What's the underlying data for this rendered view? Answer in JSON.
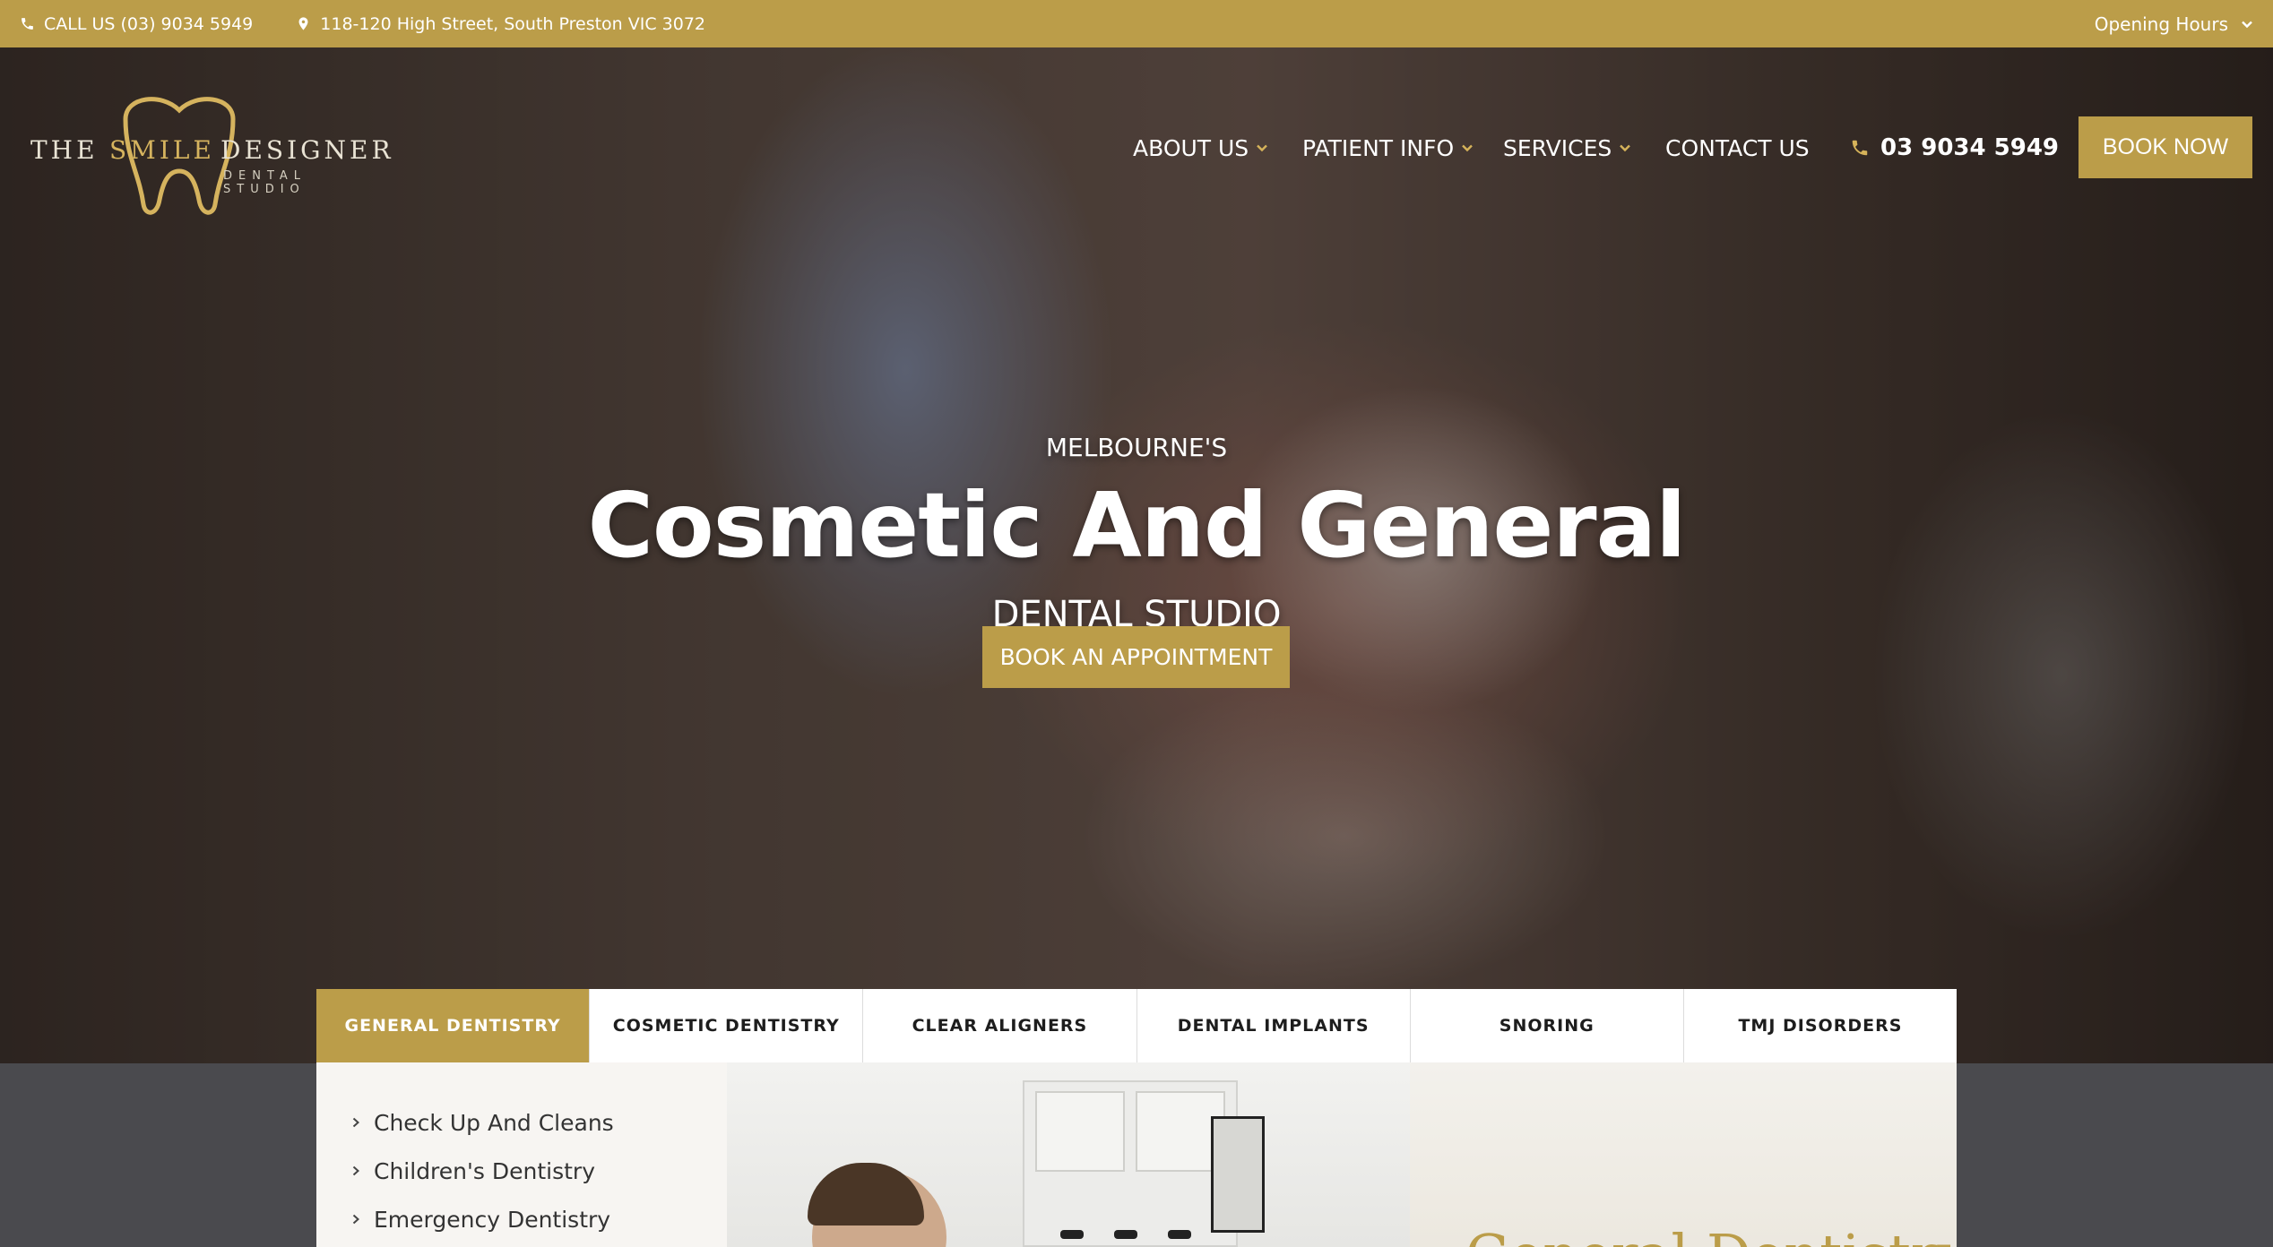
{
  "topbar": {
    "call": "CALL US (03) 9034 5949",
    "address": "118-120 High Street, South Preston VIC 3072",
    "hours": "Opening Hours"
  },
  "logo": {
    "word1": "THE",
    "word2": "SMILE",
    "word3": "DESIGNER",
    "subtitle": "DENTAL STUDIO"
  },
  "nav": {
    "about": "ABOUT US",
    "patient": "PATIENT INFO",
    "services": "SERVICES",
    "contact": "CONTACT US",
    "phone": "03 9034 5949",
    "book": "BOOK NOW"
  },
  "hero": {
    "kicker": "MELBOURNE'S",
    "headline": "Cosmetic And General",
    "subline": "DENTAL STUDIO",
    "cta": "BOOK AN APPOINTMENT"
  },
  "tabs": [
    "GENERAL DENTISTRY",
    "COSMETIC DENTISTRY",
    "CLEAR ALIGNERS",
    "DENTAL IMPLANTS",
    "SNORING",
    "TMJ DISORDERS"
  ],
  "panel": {
    "items": [
      "Check Up And Cleans",
      "Children's Dentistry",
      "Emergency Dentistry"
    ],
    "title": "General Dentistry"
  },
  "colors": {
    "accent": "#bb9d49",
    "dark_band": "#4a4a4e"
  }
}
